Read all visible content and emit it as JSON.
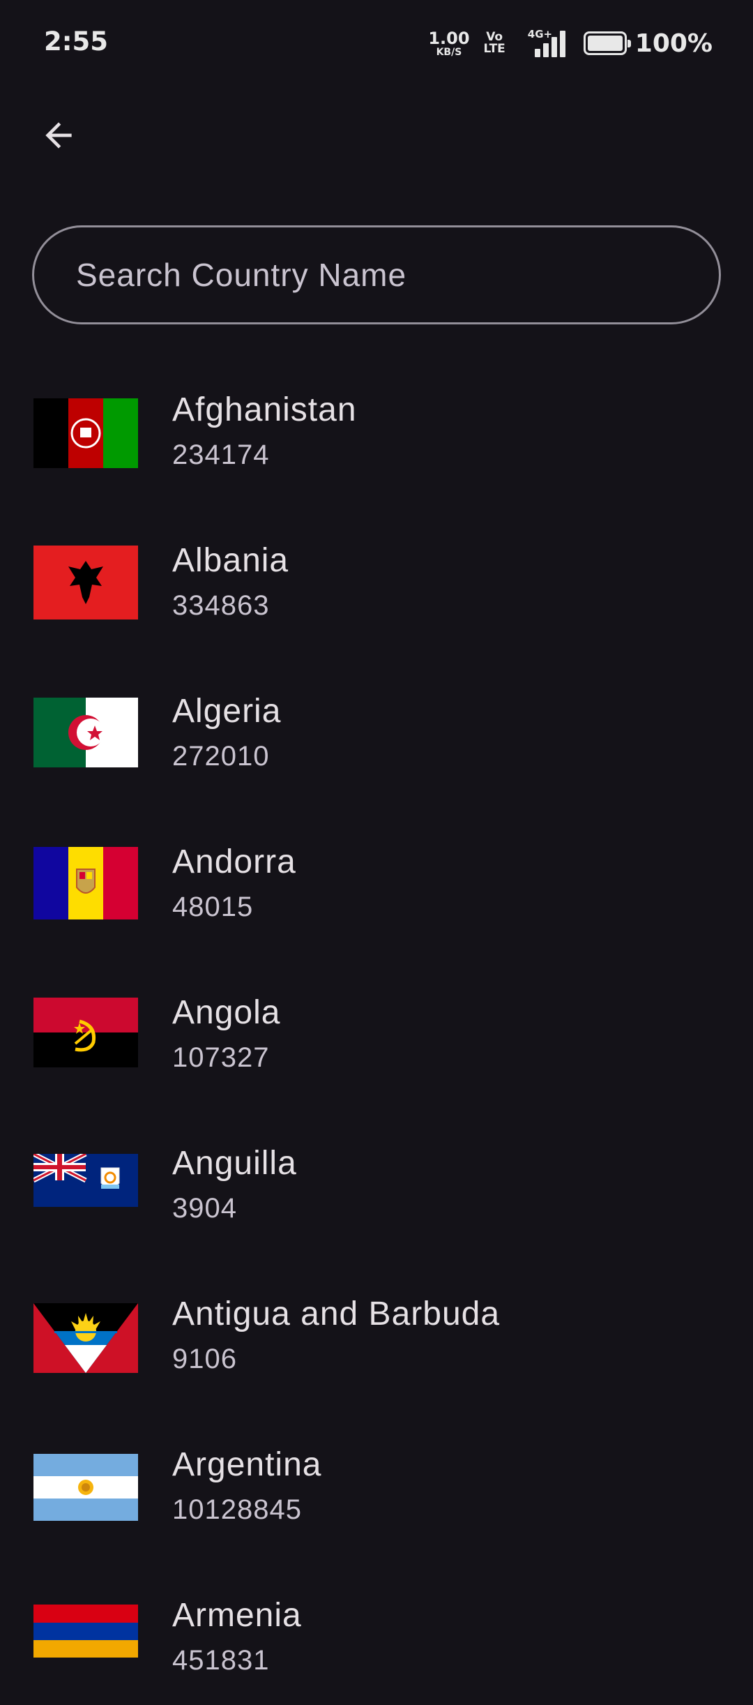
{
  "status_bar": {
    "time": "2:55",
    "net_speed_value": "1.00",
    "net_speed_unit": "KB/S",
    "volte_top": "Vo",
    "volte_bottom": "LTE",
    "network_type": "4G+",
    "battery_percent": "100%",
    "battery_level": 1.0
  },
  "search": {
    "placeholder": "Search Country Name",
    "value": ""
  },
  "countries": [
    {
      "name": "Afghanistan",
      "value": "234174",
      "flag_icon": "afghanistan-flag-icon"
    },
    {
      "name": "Albania",
      "value": "334863",
      "flag_icon": "albania-flag-icon"
    },
    {
      "name": "Algeria",
      "value": "272010",
      "flag_icon": "algeria-flag-icon"
    },
    {
      "name": "Andorra",
      "value": "48015",
      "flag_icon": "andorra-flag-icon"
    },
    {
      "name": "Angola",
      "value": "107327",
      "flag_icon": "angola-flag-icon"
    },
    {
      "name": "Anguilla",
      "value": "3904",
      "flag_icon": "anguilla-flag-icon"
    },
    {
      "name": "Antigua and Barbuda",
      "value": "9106",
      "flag_icon": "antigua-flag-icon"
    },
    {
      "name": "Argentina",
      "value": "10128845",
      "flag_icon": "argentina-flag-icon"
    },
    {
      "name": "Armenia",
      "value": "451831",
      "flag_icon": "armenia-flag-icon"
    }
  ],
  "colors": {
    "background": "#141218",
    "outline": "#938f99",
    "primary_text": "#e6e1e5",
    "secondary_text": "#cac4d0"
  }
}
